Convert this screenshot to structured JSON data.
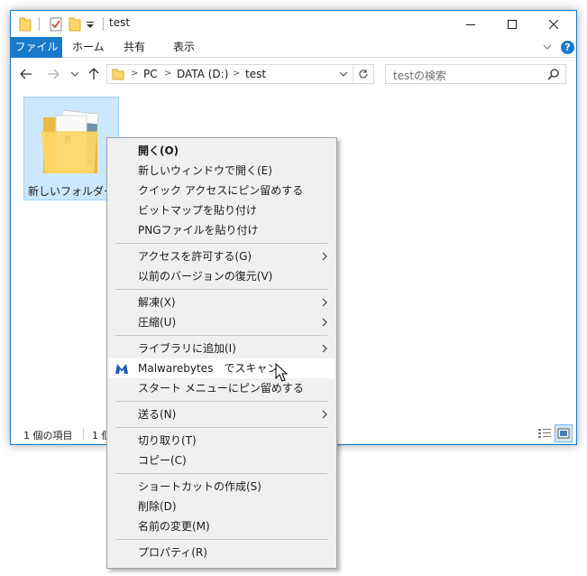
{
  "window": {
    "title": "test"
  },
  "ribbon": {
    "file": "ファイル",
    "home": "ホーム",
    "share": "共有",
    "view": "表示",
    "help": "?"
  },
  "nav": {
    "crumbs": [
      "PC",
      "DATA (D:)",
      "test"
    ],
    "search_placeholder": "testの検索"
  },
  "content": {
    "items": [
      {
        "label": "新しいフォルダー"
      }
    ]
  },
  "status": {
    "item_count": "1 個の項目",
    "selected": "1 個"
  },
  "context_menu": {
    "items": [
      {
        "label": "開く(O)"
      },
      {
        "label": "新しいウィンドウで開く(E)"
      },
      {
        "label": "クイック アクセスにピン留めする"
      },
      {
        "label": "ビットマップを貼り付け"
      },
      {
        "label": "PNGファイルを貼り付け"
      },
      {
        "label": "アクセスを許可する(G)"
      },
      {
        "label": "以前のバージョンの復元(V)"
      },
      {
        "label": "解凍(X)"
      },
      {
        "label": "圧縮(U)"
      },
      {
        "label": "ライブラリに追加(I)"
      },
      {
        "label": "Malwarebytes　でスキャン"
      },
      {
        "label": "スタート メニューにピン留めする"
      },
      {
        "label": "送る(N)"
      },
      {
        "label": "切り取り(T)"
      },
      {
        "label": "コピー(C)"
      },
      {
        "label": "ショートカットの作成(S)"
      },
      {
        "label": "削除(D)"
      },
      {
        "label": "名前の変更(M)"
      },
      {
        "label": "プロパティ(R)"
      }
    ]
  },
  "colors": {
    "accent": "#1979ca",
    "selection": "#cce8ff",
    "folder": "#ffd766",
    "menu_bg": "#f0f0f0"
  }
}
